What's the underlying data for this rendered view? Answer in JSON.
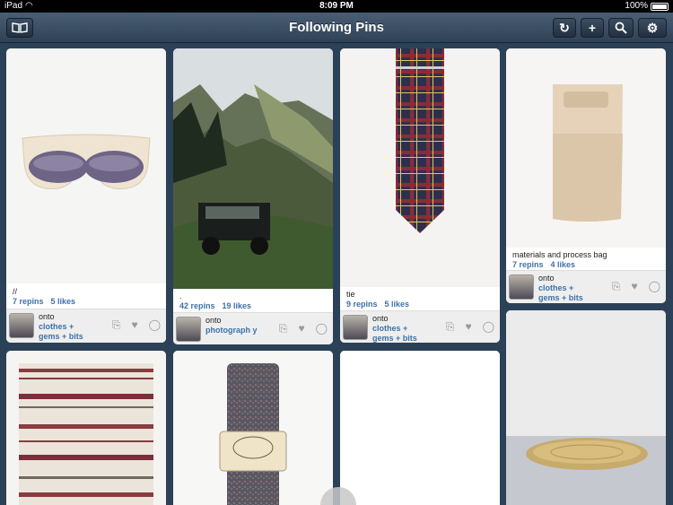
{
  "status_bar": {
    "carrier": "iPad",
    "time": "8:09 PM",
    "battery": "100%"
  },
  "nav": {
    "title": "Following Pins",
    "icons": [
      "book-icon",
      "refresh-icon",
      "plus-icon",
      "search-icon",
      "gear-icon"
    ]
  },
  "pins": [
    {
      "caption": "//",
      "repins": "7 repins",
      "likes": "5 likes",
      "onto": "onto",
      "board": "clothes + gems + bits"
    },
    {
      "caption": ".",
      "repins": "42 repins",
      "likes": "19 likes",
      "onto": "onto",
      "board": "photograph y"
    },
    {
      "caption": "tie",
      "repins": "9 repins",
      "likes": "5 likes",
      "onto": "onto",
      "board": "clothes + gems + bits"
    },
    {
      "caption": "materials and process bag",
      "repins": "7 repins",
      "likes": "4 likes",
      "onto": "onto",
      "board": "clothes + gems + bits"
    }
  ]
}
